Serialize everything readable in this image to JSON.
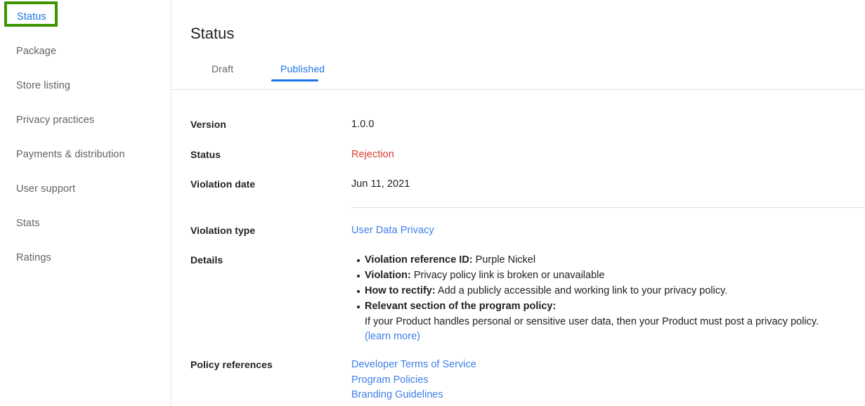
{
  "sidebar": {
    "items": [
      {
        "label": "Status",
        "active": true,
        "highlighted": true
      },
      {
        "label": "Package",
        "active": false,
        "highlighted": false
      },
      {
        "label": "Store listing",
        "active": false,
        "highlighted": false
      },
      {
        "label": "Privacy practices",
        "active": false,
        "highlighted": false
      },
      {
        "label": "Payments & distribution",
        "active": false,
        "highlighted": false
      },
      {
        "label": "User support",
        "active": false,
        "highlighted": false
      },
      {
        "label": "Stats",
        "active": false,
        "highlighted": false
      },
      {
        "label": "Ratings",
        "active": false,
        "highlighted": false
      }
    ],
    "highlight_color": "#3d9400"
  },
  "main": {
    "title": "Status",
    "tabs": [
      {
        "label": "Draft",
        "selected": false
      },
      {
        "label": "Published",
        "selected": true
      }
    ],
    "fields": {
      "version": {
        "label": "Version",
        "value": "1.0.0"
      },
      "status": {
        "label": "Status",
        "value": "Rejection",
        "color": "#d93b30"
      },
      "violation_date": {
        "label": "Violation date",
        "value": "Jun 11, 2021"
      },
      "violation_type": {
        "label": "Violation type",
        "value": "User Data Privacy",
        "is_link": true
      },
      "details": {
        "label": "Details"
      },
      "policy_references": {
        "label": "Policy references"
      }
    },
    "details": {
      "bullets": [
        {
          "term": "Violation reference ID:",
          "text": " Purple Nickel"
        },
        {
          "term": "Violation:",
          "text": " Privacy policy link is broken or unavailable"
        },
        {
          "term": "How to rectify:",
          "text": " Add a publicly accessible and working link to your privacy policy."
        },
        {
          "term": "Relevant section of the program policy:",
          "text": ""
        }
      ],
      "policy_quote": "If your Product handles personal or sensitive user data, then your Product must post a privacy policy.",
      "learn_more": "(learn more)"
    },
    "policy_references": [
      "Developer Terms of Service",
      "Program Policies",
      "Branding Guidelines"
    ]
  },
  "colors": {
    "link": "#3f7ee8",
    "accent": "#1a73e8",
    "error": "#d93b30",
    "text": "#202124",
    "muted": "#5f6368",
    "highlight": "#3d9400"
  }
}
